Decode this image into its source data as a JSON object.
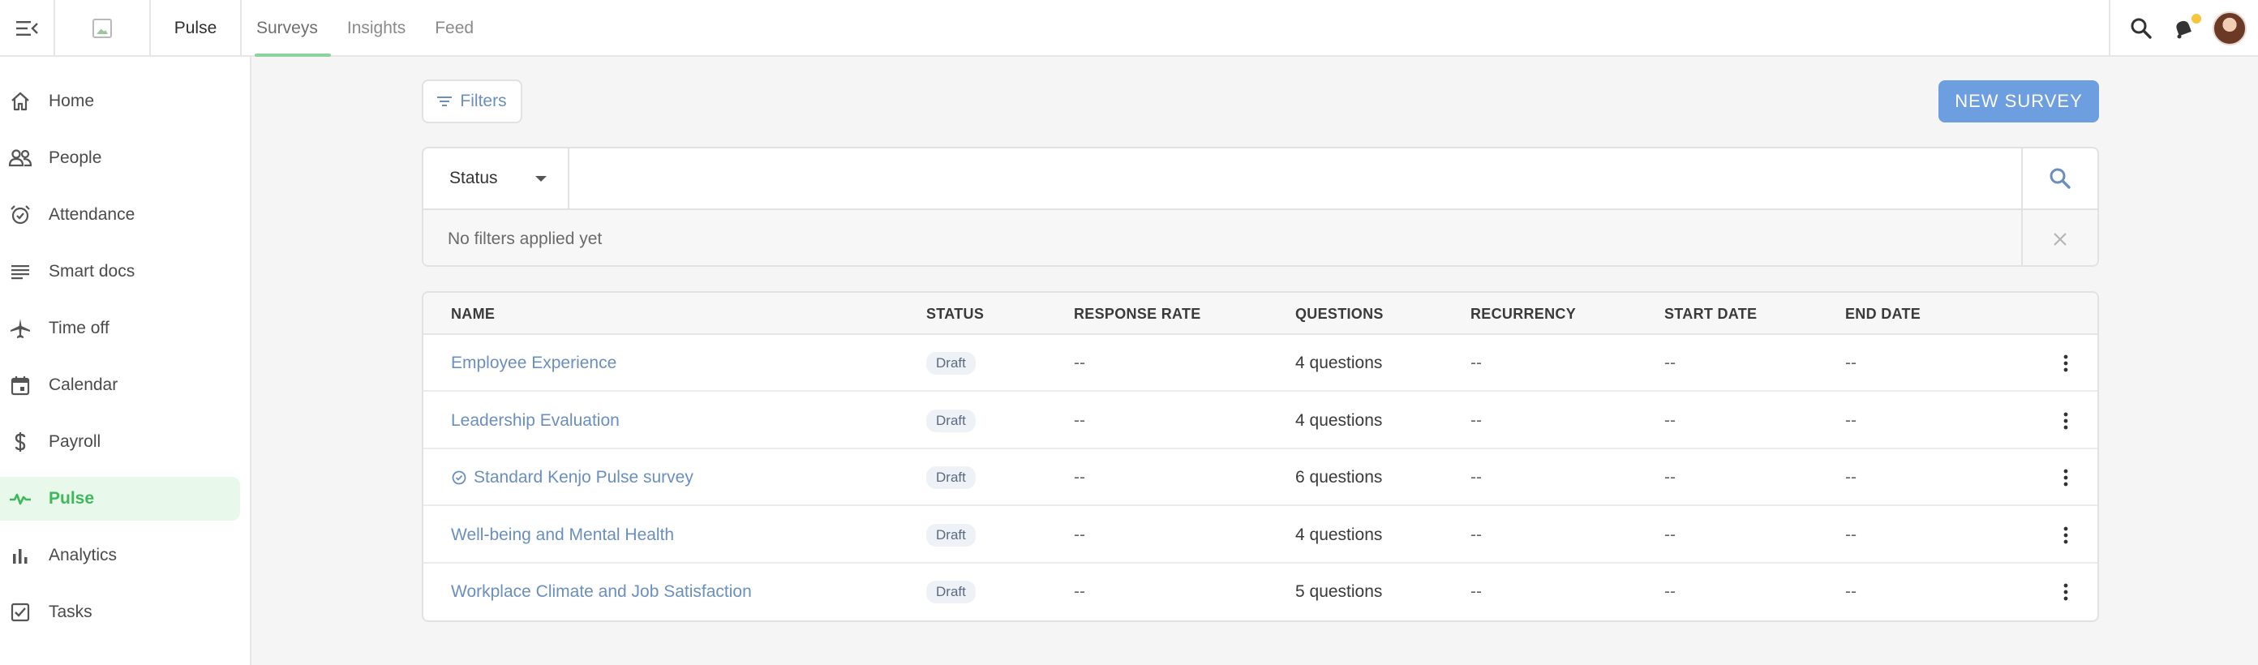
{
  "app": {
    "name": "Pulse",
    "tabs": [
      {
        "label": "Surveys",
        "active": true
      },
      {
        "label": "Insights",
        "active": false
      },
      {
        "label": "Feed",
        "active": false
      }
    ],
    "icons": {
      "menu": "menu-collapse-icon",
      "logo": "broken-image-icon",
      "search": "search-icon",
      "notifications": "bell-icon",
      "avatar": "user-avatar"
    },
    "notification_dot_color": "#f6c53b"
  },
  "sidebar": {
    "items": [
      {
        "label": "Home",
        "icon": "home-icon"
      },
      {
        "label": "People",
        "icon": "people-icon"
      },
      {
        "label": "Attendance",
        "icon": "alarm-clock-icon"
      },
      {
        "label": "Smart docs",
        "icon": "lines-icon"
      },
      {
        "label": "Time off",
        "icon": "airplane-icon"
      },
      {
        "label": "Calendar",
        "icon": "calendar-icon"
      },
      {
        "label": "Payroll",
        "icon": "dollar-icon"
      },
      {
        "label": "Pulse",
        "icon": "pulse-icon",
        "active": true
      },
      {
        "label": "Analytics",
        "icon": "bar-chart-icon"
      },
      {
        "label": "Tasks",
        "icon": "checkbox-icon"
      }
    ],
    "active_color": "#3eb95a"
  },
  "toolbar": {
    "filters_label": "Filters",
    "new_survey_label": "NEW SURVEY",
    "new_survey_color": "#6d9ee0"
  },
  "filter_panel": {
    "status_label": "Status",
    "search_value": "",
    "no_filters_text": "No filters applied yet"
  },
  "table": {
    "columns": [
      "NAME",
      "STATUS",
      "RESPONSE RATE",
      "QUESTIONS",
      "RECURRENCY",
      "START DATE",
      "END DATE"
    ],
    "rows": [
      {
        "name": "Employee Experience",
        "status": "Draft",
        "response_rate": "--",
        "questions": "4 questions",
        "recurrency": "--",
        "start_date": "--",
        "end_date": "--",
        "verified": false
      },
      {
        "name": "Leadership Evaluation",
        "status": "Draft",
        "response_rate": "--",
        "questions": "4 questions",
        "recurrency": "--",
        "start_date": "--",
        "end_date": "--",
        "verified": false
      },
      {
        "name": "Standard Kenjo Pulse survey",
        "status": "Draft",
        "response_rate": "--",
        "questions": "6 questions",
        "recurrency": "--",
        "start_date": "--",
        "end_date": "--",
        "verified": true
      },
      {
        "name": "Well-being and Mental Health",
        "status": "Draft",
        "response_rate": "--",
        "questions": "4 questions",
        "recurrency": "--",
        "start_date": "--",
        "end_date": "--",
        "verified": false
      },
      {
        "name": "Workplace Climate and Job Satisfaction",
        "status": "Draft",
        "response_rate": "--",
        "questions": "5 questions",
        "recurrency": "--",
        "start_date": "--",
        "end_date": "--",
        "verified": false
      }
    ],
    "link_color": "#6a8fbf"
  }
}
